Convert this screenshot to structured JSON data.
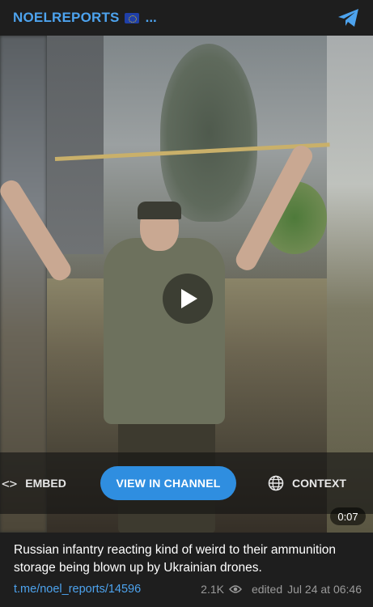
{
  "header": {
    "channel_name": "NOELREPORTS",
    "flag_icon": "eu-flag-icon",
    "ellipsis": "...",
    "telegram_icon": "telegram-logo-icon",
    "accent_color": "#4da3ee"
  },
  "media": {
    "play_icon": "play-icon",
    "duration": "0:07",
    "actions": {
      "embed_label": "EMBED",
      "embed_icon": "code-brackets-icon",
      "view_label": "VIEW IN CHANNEL",
      "context_label": "CONTEXT",
      "context_icon": "globe-icon",
      "button_color": "#2f8ee0"
    }
  },
  "post": {
    "caption": "Russian infantry reacting kind of weird to their ammunition storage being blown up by Ukrainian drones.",
    "link": "t.me/noel_reports/14596",
    "views": "2.1K",
    "views_icon": "eye-icon",
    "edited_label": "edited",
    "date": "Jul 24 at 06:46"
  }
}
